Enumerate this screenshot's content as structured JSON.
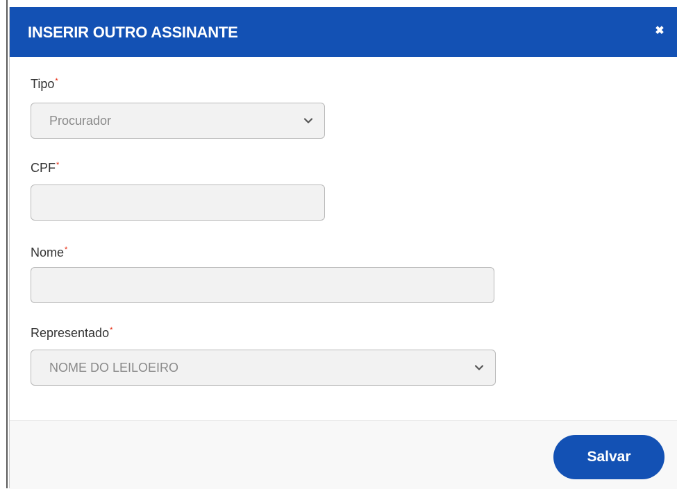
{
  "modal": {
    "title": "INSERIR OUTRO ASSINANTE",
    "close_icon": "close-icon"
  },
  "form": {
    "required_marker": "*",
    "tipo": {
      "label": "Tipo",
      "value": "Procurador"
    },
    "cpf": {
      "label": "CPF",
      "value": ""
    },
    "nome": {
      "label": "Nome",
      "value": ""
    },
    "representado": {
      "label": "Representado",
      "value": "NOME DO LEILOEIRO"
    }
  },
  "footer": {
    "save_label": "Salvar"
  },
  "colors": {
    "header_bg": "#1351b4",
    "save_bg": "#1351b4",
    "required": "#e52207",
    "field_bg": "#f2f2f2"
  }
}
